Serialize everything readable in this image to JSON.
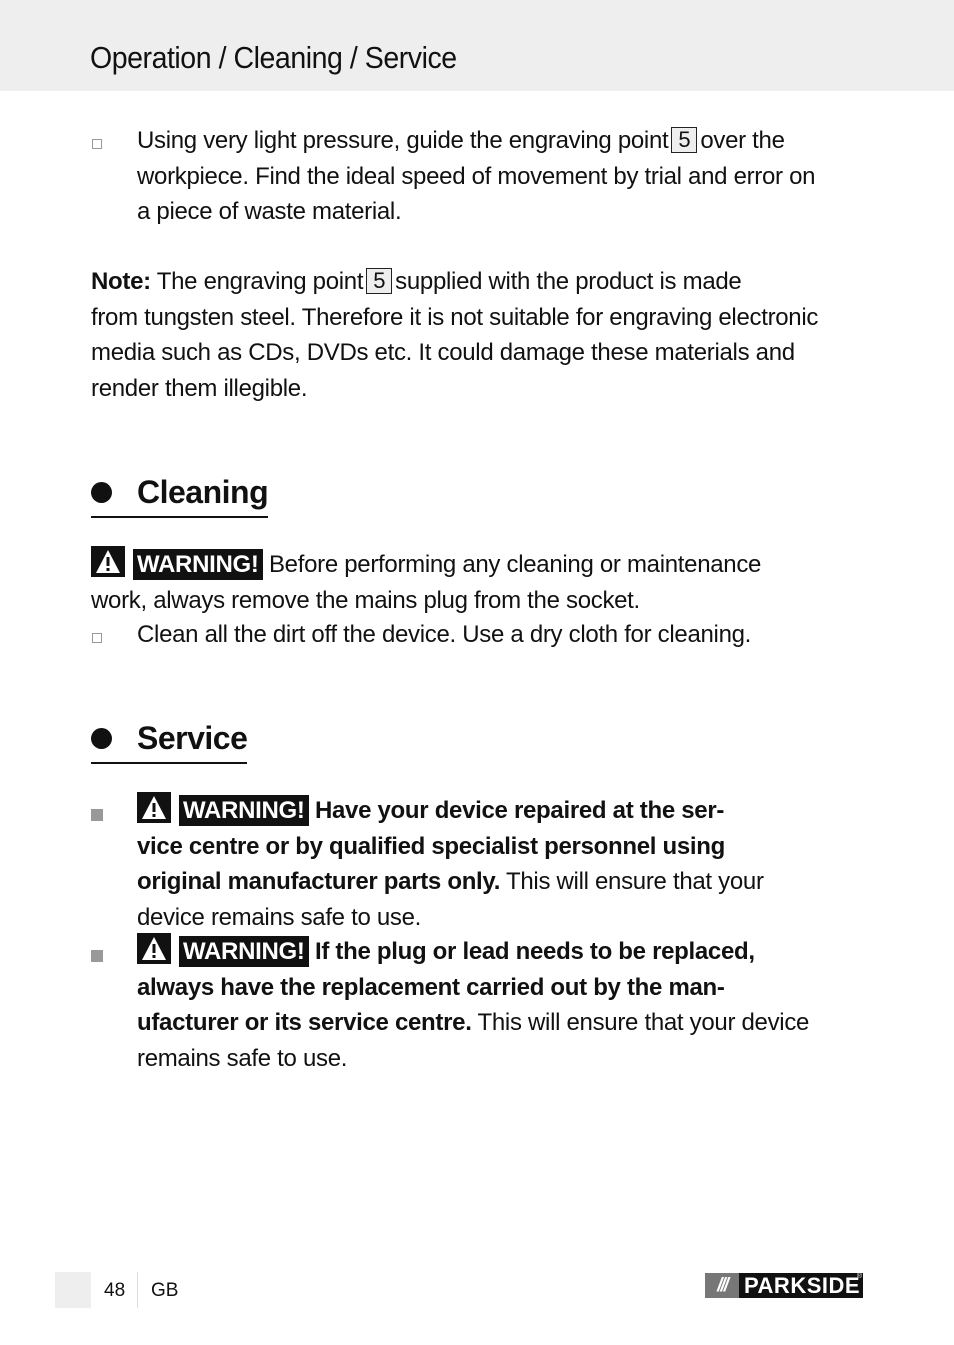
{
  "header": {
    "title": "Operation / Cleaning / Service"
  },
  "operation": {
    "step": {
      "text_before": "Using very light pressure, guide the engraving point",
      "ref": "5",
      "text_after": "over the",
      "line2": "workpiece. Find the ideal speed of movement by trial and error on",
      "line3": "a piece of waste material."
    },
    "note": {
      "label": "Note:",
      "text_before": "The engraving point",
      "ref": "5",
      "text_after": "supplied with the product is made",
      "line2": "from tungsten steel. Therefore it is not suitable for engraving electronic",
      "line3": "media such as CDs, DVDs etc. It could damage these materials and",
      "line4": "render them illegible."
    }
  },
  "cleaning": {
    "title": "Cleaning",
    "warning_label": "WARNING!",
    "warning_text": "Before performing any cleaning or maintenance",
    "warning_line2": "work, always remove the mains plug from the socket.",
    "step": "Clean all the dirt off the device. Use a dry cloth for cleaning."
  },
  "service": {
    "title": "Service",
    "items": [
      {
        "warning_label": "WARNING!",
        "bold_line1": "Have your device repaired at the ser-",
        "bold_line2": "vice centre or by qualified specialist personnel using",
        "bold_line3": "original manufacturer parts only.",
        "normal_line3": "This will ensure that your",
        "normal_line4": "device remains safe to use."
      },
      {
        "warning_label": "WARNING!",
        "bold_line1": "If the plug or lead needs to be replaced,",
        "bold_line2": "always have the replacement carried out by the man-",
        "bold_line3": "ufacturer or its service centre.",
        "normal_line3": "This will ensure that your device",
        "normal_line4": "remains safe to use."
      }
    ]
  },
  "footer": {
    "page_number": "48",
    "language": "GB",
    "brand": "PARKSIDE",
    "brand_slashes": "///",
    "brand_reg": "®"
  }
}
